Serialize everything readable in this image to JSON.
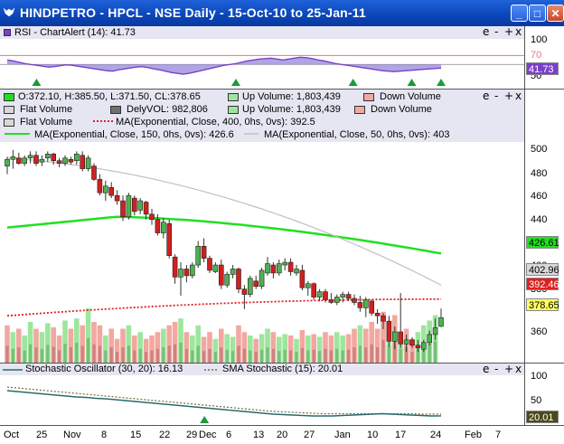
{
  "window": {
    "title": "HINDPETRO - HPCL - NSE Daily - 15-Oct-10 to 25-Jan-11",
    "buttons": {
      "minimize": "_",
      "maximize": "□",
      "close": "✕"
    },
    "icon": "bull-logo-icon"
  },
  "panel_controls": {
    "collapse": "e",
    "minus": "-",
    "plus": "+",
    "close": "x"
  },
  "rsi_panel": {
    "title": "RSI - ChartAlert (14): 41.73",
    "ticks": [
      "100",
      "50"
    ],
    "level70": "70",
    "value_tag": "41.73",
    "colors": {
      "line": "#7b40c8",
      "fill": "#8e7fd8",
      "level": "#e87a7a",
      "signal": "#1a9a3a"
    }
  },
  "price_panel": {
    "legend": {
      "ohlc": "O:372.10, H:385.50, L:371.50, CL:378.65",
      "up_volume_1": "Up Volume: 1,803,439",
      "down_volume_1": "Down Volume",
      "flat_volume_1": "Flat Volume",
      "dely_vol": "DelyVOL: 982,806",
      "up_volume_2": "Up Volume: 1,803,439",
      "flat_volume_2": "Flat Volume",
      "ma400": "MA(Exponential, Close, 400, 0hs, 0vs): 392.5",
      "down_volume_2": "Down Volume",
      "ma150": "MA(Exponential, Close, 150, 0hs, 0vs): 426.6",
      "ma50": "MA(Exponential, Close, 50, 0hs, 0vs): 403"
    },
    "ticks": [
      "500",
      "480",
      "460",
      "440",
      "420",
      "400",
      "380",
      "360"
    ],
    "tags": {
      "ma150": "426.61",
      "ma50": "402.96",
      "ma400": "392.46",
      "close": "378.65"
    },
    "colors": {
      "ma150": "#20e020",
      "ma50": "#c0c0c0",
      "ma400": "#e02020",
      "up": "#4fb04f",
      "down": "#d02020",
      "up_vol": "#9ee69e",
      "down_vol": "#f2a8a0"
    }
  },
  "stoch_panel": {
    "title1": "Stochastic Oscillator (30, 20): 16.13",
    "title2": "SMA Stochastic (15): 20.01",
    "ticks": [
      "100",
      "50"
    ],
    "value_tag": "20.01",
    "colors": {
      "k": "#2a6a6a",
      "d": "#7a6a3a"
    }
  },
  "x_axis": {
    "labels": [
      "Oct",
      "25",
      "Nov",
      "8",
      "15",
      "22",
      "29",
      "Dec",
      "6",
      "13",
      "20",
      "27",
      "Jan",
      "10",
      "17",
      "24",
      "Feb",
      "7"
    ]
  },
  "chart_data": {
    "type": "candlestick",
    "price_range": [
      345,
      510
    ],
    "candles": [
      {
        "o": 492,
        "h": 499,
        "l": 486,
        "c": 497
      },
      {
        "o": 497,
        "h": 504,
        "l": 490,
        "c": 499
      },
      {
        "o": 498,
        "h": 502,
        "l": 493,
        "c": 494
      },
      {
        "o": 494,
        "h": 500,
        "l": 492,
        "c": 498
      },
      {
        "o": 498,
        "h": 503,
        "l": 494,
        "c": 500
      },
      {
        "o": 500,
        "h": 503,
        "l": 492,
        "c": 494
      },
      {
        "o": 495,
        "h": 500,
        "l": 492,
        "c": 497
      },
      {
        "o": 498,
        "h": 503,
        "l": 495,
        "c": 501
      },
      {
        "o": 501,
        "h": 502,
        "l": 493,
        "c": 496
      },
      {
        "o": 496,
        "h": 498,
        "l": 491,
        "c": 494
      },
      {
        "o": 494,
        "h": 500,
        "l": 492,
        "c": 498
      },
      {
        "o": 497,
        "h": 499,
        "l": 493,
        "c": 495
      },
      {
        "o": 496,
        "h": 503,
        "l": 493,
        "c": 501
      },
      {
        "o": 500,
        "h": 503,
        "l": 488,
        "c": 490
      },
      {
        "o": 490,
        "h": 500,
        "l": 488,
        "c": 498
      },
      {
        "o": 492,
        "h": 494,
        "l": 481,
        "c": 482
      },
      {
        "o": 482,
        "h": 486,
        "l": 470,
        "c": 472
      },
      {
        "o": 472,
        "h": 481,
        "l": 466,
        "c": 477
      },
      {
        "o": 476,
        "h": 480,
        "l": 468,
        "c": 470
      },
      {
        "o": 470,
        "h": 474,
        "l": 463,
        "c": 466
      },
      {
        "o": 466,
        "h": 470,
        "l": 451,
        "c": 454
      },
      {
        "o": 454,
        "h": 472,
        "l": 452,
        "c": 470
      },
      {
        "o": 468,
        "h": 470,
        "l": 455,
        "c": 458
      },
      {
        "o": 459,
        "h": 468,
        "l": 456,
        "c": 466
      },
      {
        "o": 465,
        "h": 466,
        "l": 452,
        "c": 456
      },
      {
        "o": 456,
        "h": 460,
        "l": 448,
        "c": 452
      },
      {
        "o": 452,
        "h": 456,
        "l": 440,
        "c": 442
      },
      {
        "o": 442,
        "h": 453,
        "l": 438,
        "c": 450
      },
      {
        "o": 449,
        "h": 452,
        "l": 423,
        "c": 425
      },
      {
        "o": 424,
        "h": 426,
        "l": 404,
        "c": 409
      },
      {
        "o": 409,
        "h": 420,
        "l": 395,
        "c": 415
      },
      {
        "o": 415,
        "h": 418,
        "l": 405,
        "c": 410
      },
      {
        "o": 410,
        "h": 420,
        "l": 408,
        "c": 418
      },
      {
        "o": 418,
        "h": 436,
        "l": 416,
        "c": 432
      },
      {
        "o": 432,
        "h": 438,
        "l": 420,
        "c": 423
      },
      {
        "o": 423,
        "h": 425,
        "l": 412,
        "c": 414
      },
      {
        "o": 413,
        "h": 420,
        "l": 412,
        "c": 418
      },
      {
        "o": 418,
        "h": 422,
        "l": 400,
        "c": 403
      },
      {
        "o": 403,
        "h": 413,
        "l": 401,
        "c": 411
      },
      {
        "o": 411,
        "h": 418,
        "l": 408,
        "c": 415
      },
      {
        "o": 415,
        "h": 416,
        "l": 397,
        "c": 400
      },
      {
        "o": 400,
        "h": 403,
        "l": 385,
        "c": 396
      },
      {
        "o": 396,
        "h": 410,
        "l": 394,
        "c": 408
      },
      {
        "o": 406,
        "h": 410,
        "l": 400,
        "c": 402
      },
      {
        "o": 402,
        "h": 416,
        "l": 400,
        "c": 414
      },
      {
        "o": 412,
        "h": 424,
        "l": 410,
        "c": 419
      },
      {
        "o": 418,
        "h": 420,
        "l": 408,
        "c": 412
      },
      {
        "o": 412,
        "h": 422,
        "l": 410,
        "c": 419
      },
      {
        "o": 418,
        "h": 423,
        "l": 414,
        "c": 420
      },
      {
        "o": 420,
        "h": 423,
        "l": 410,
        "c": 413
      },
      {
        "o": 412,
        "h": 418,
        "l": 410,
        "c": 415
      },
      {
        "o": 414,
        "h": 418,
        "l": 399,
        "c": 401
      },
      {
        "o": 401,
        "h": 406,
        "l": 395,
        "c": 404
      },
      {
        "o": 404,
        "h": 405,
        "l": 392,
        "c": 394
      },
      {
        "o": 394,
        "h": 400,
        "l": 391,
        "c": 398
      },
      {
        "o": 398,
        "h": 400,
        "l": 390,
        "c": 392
      },
      {
        "o": 392,
        "h": 397,
        "l": 389,
        "c": 390
      },
      {
        "o": 390,
        "h": 396,
        "l": 388,
        "c": 394
      },
      {
        "o": 394,
        "h": 398,
        "l": 390,
        "c": 396
      },
      {
        "o": 396,
        "h": 398,
        "l": 391,
        "c": 393
      },
      {
        "o": 393,
        "h": 396,
        "l": 388,
        "c": 390
      },
      {
        "o": 390,
        "h": 395,
        "l": 383,
        "c": 386
      },
      {
        "o": 386,
        "h": 394,
        "l": 379,
        "c": 392
      },
      {
        "o": 391,
        "h": 392,
        "l": 380,
        "c": 382
      },
      {
        "o": 382,
        "h": 385,
        "l": 374,
        "c": 380
      },
      {
        "o": 380,
        "h": 382,
        "l": 370,
        "c": 376
      },
      {
        "o": 376,
        "h": 380,
        "l": 357,
        "c": 361
      },
      {
        "o": 361,
        "h": 372,
        "l": 355,
        "c": 368
      },
      {
        "o": 368,
        "h": 397,
        "l": 356,
        "c": 359
      },
      {
        "o": 359,
        "h": 366,
        "l": 353,
        "c": 362
      },
      {
        "o": 362,
        "h": 364,
        "l": 356,
        "c": 358
      },
      {
        "o": 358,
        "h": 362,
        "l": 353,
        "c": 356
      },
      {
        "o": 355,
        "h": 362,
        "l": 353,
        "c": 360
      },
      {
        "o": 360,
        "h": 369,
        "l": 358,
        "c": 366
      },
      {
        "o": 366,
        "h": 378,
        "l": 362,
        "c": 371
      },
      {
        "o": 372.1,
        "h": 385.5,
        "l": 371.5,
        "c": 378.65
      }
    ],
    "volume": [
      {
        "v": 0.55,
        "up": false
      },
      {
        "v": 0.45,
        "up": true
      },
      {
        "v": 0.5,
        "up": false
      },
      {
        "v": 0.4,
        "up": true
      },
      {
        "v": 0.6,
        "up": true
      },
      {
        "v": 0.5,
        "up": false
      },
      {
        "v": 0.45,
        "up": true
      },
      {
        "v": 0.58,
        "up": true
      },
      {
        "v": 0.52,
        "up": false
      },
      {
        "v": 0.4,
        "up": false
      },
      {
        "v": 0.62,
        "up": true
      },
      {
        "v": 0.5,
        "up": false
      },
      {
        "v": 0.65,
        "up": true
      },
      {
        "v": 0.55,
        "up": false
      },
      {
        "v": 0.8,
        "up": true
      },
      {
        "v": 0.6,
        "up": false
      },
      {
        "v": 0.55,
        "up": false
      },
      {
        "v": 0.4,
        "up": true
      },
      {
        "v": 0.5,
        "up": false
      },
      {
        "v": 0.35,
        "up": false
      },
      {
        "v": 0.5,
        "up": false
      },
      {
        "v": 0.55,
        "up": true
      },
      {
        "v": 0.4,
        "up": false
      },
      {
        "v": 0.45,
        "up": true
      },
      {
        "v": 0.35,
        "up": false
      },
      {
        "v": 0.4,
        "up": false
      },
      {
        "v": 0.45,
        "up": false
      },
      {
        "v": 0.5,
        "up": true
      },
      {
        "v": 0.55,
        "up": false
      },
      {
        "v": 0.6,
        "up": false
      },
      {
        "v": 0.65,
        "up": true
      },
      {
        "v": 0.45,
        "up": false
      },
      {
        "v": 0.4,
        "up": true
      },
      {
        "v": 0.55,
        "up": true
      },
      {
        "v": 0.38,
        "up": false
      },
      {
        "v": 0.45,
        "up": false
      },
      {
        "v": 0.35,
        "up": true
      },
      {
        "v": 0.5,
        "up": false
      },
      {
        "v": 0.42,
        "up": true
      },
      {
        "v": 0.38,
        "up": true
      },
      {
        "v": 0.55,
        "up": false
      },
      {
        "v": 0.45,
        "up": false
      },
      {
        "v": 0.4,
        "up": true
      },
      {
        "v": 0.35,
        "up": false
      },
      {
        "v": 0.42,
        "up": true
      },
      {
        "v": 0.5,
        "up": true
      },
      {
        "v": 0.45,
        "up": false
      },
      {
        "v": 0.38,
        "up": true
      },
      {
        "v": 0.42,
        "up": true
      },
      {
        "v": 0.4,
        "up": false
      },
      {
        "v": 0.35,
        "up": true
      },
      {
        "v": 0.48,
        "up": false
      },
      {
        "v": 0.4,
        "up": true
      },
      {
        "v": 0.42,
        "up": false
      },
      {
        "v": 0.38,
        "up": true
      },
      {
        "v": 0.45,
        "up": false
      },
      {
        "v": 0.4,
        "up": false
      },
      {
        "v": 0.45,
        "up": true
      },
      {
        "v": 0.4,
        "up": true
      },
      {
        "v": 0.42,
        "up": false
      },
      {
        "v": 0.5,
        "up": false
      },
      {
        "v": 0.55,
        "up": true
      },
      {
        "v": 0.5,
        "up": false
      },
      {
        "v": 0.6,
        "up": false
      },
      {
        "v": 0.5,
        "up": false
      },
      {
        "v": 0.75,
        "up": false
      },
      {
        "v": 0.55,
        "up": true
      },
      {
        "v": 0.7,
        "up": false
      },
      {
        "v": 0.45,
        "up": true
      },
      {
        "v": 0.5,
        "up": false
      },
      {
        "v": 0.35,
        "up": false
      },
      {
        "v": 0.45,
        "up": true
      },
      {
        "v": 0.55,
        "up": true
      },
      {
        "v": 0.62,
        "up": true
      },
      {
        "v": 0.7,
        "up": true
      }
    ],
    "ma150": {
      "start": 446,
      "peak": 454,
      "end": 426.61
    },
    "ma50": {
      "start": 498,
      "end": 402.96
    },
    "ma400": {
      "start": 380,
      "end": 392.46
    },
    "rsi": [
      60,
      58,
      55,
      52,
      50,
      48,
      46,
      44,
      45,
      47,
      49,
      48,
      46,
      44,
      42,
      40,
      38,
      36,
      35,
      38,
      40,
      42,
      44,
      45,
      43,
      40,
      38,
      35,
      32,
      30,
      28,
      30,
      33,
      36,
      39,
      42,
      45,
      48,
      50,
      52,
      55,
      58,
      60,
      62,
      63,
      64,
      62,
      60,
      62,
      64,
      66,
      65,
      63,
      60,
      58,
      55,
      52,
      50,
      48,
      46,
      44,
      42,
      40,
      38,
      36,
      35,
      34,
      35,
      36,
      37,
      38,
      39,
      40,
      41,
      41.73
    ],
    "rsi_signals": [
      5,
      39,
      59,
      69,
      74
    ],
    "stoch_k": [
      72,
      70,
      68,
      66,
      64,
      62,
      60,
      58,
      57,
      55,
      54,
      52,
      50,
      48,
      46,
      44,
      42,
      40,
      38,
      36,
      34,
      32,
      30,
      28,
      26,
      24,
      22,
      20,
      19,
      18,
      17,
      16,
      16,
      16,
      17,
      18,
      19,
      20,
      21,
      20,
      19,
      18,
      17,
      16,
      16.13
    ],
    "stoch_d": [
      80,
      78,
      76,
      74,
      72,
      70,
      68,
      66,
      64,
      62,
      60,
      58,
      56,
      54,
      52,
      50,
      48,
      46,
      44,
      42,
      40,
      38,
      36,
      34,
      32,
      30,
      28,
      26,
      25,
      24,
      23,
      22,
      21,
      21,
      21,
      21,
      21,
      21,
      21,
      21,
      21,
      21,
      20,
      20,
      20.01
    ],
    "stoch_signal": 20
  }
}
